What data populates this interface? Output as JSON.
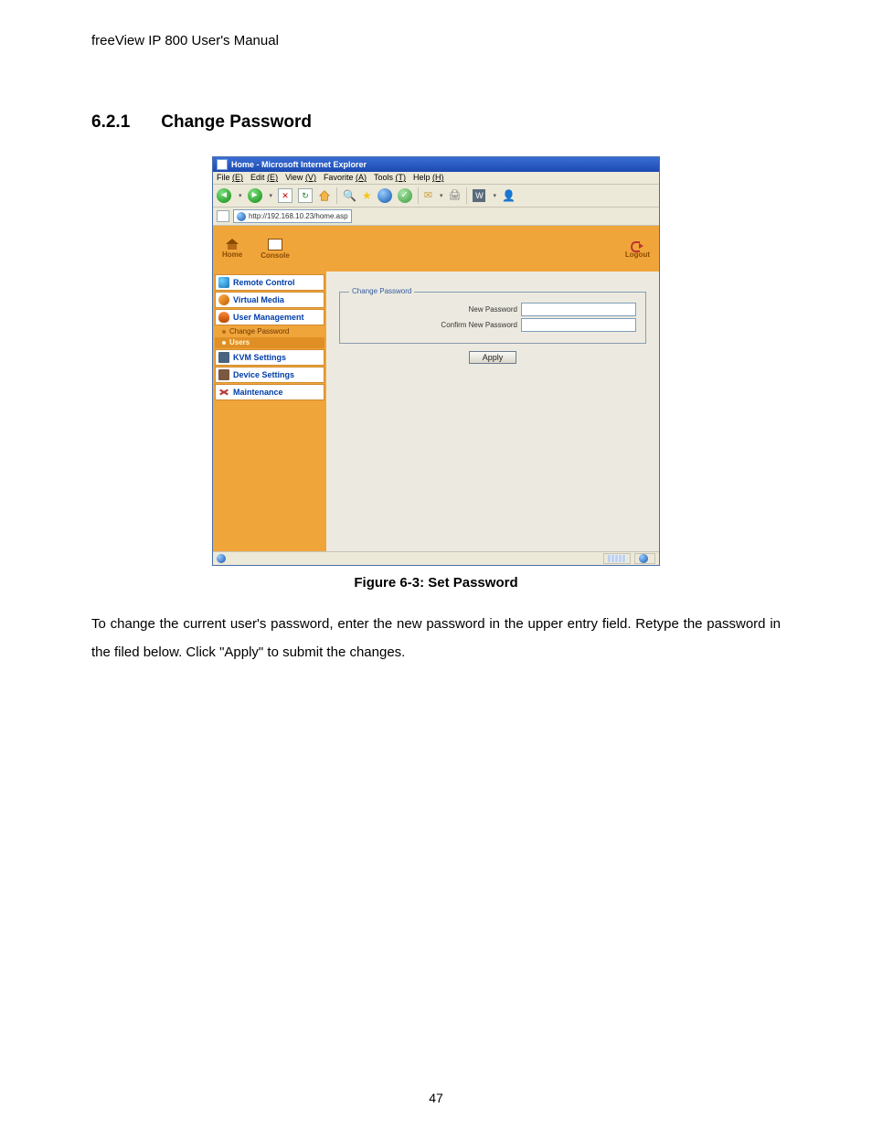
{
  "doc": {
    "header": "freeView IP 800 User's Manual",
    "section_number": "6.2.1",
    "section_title": "Change Password",
    "caption": "Figure 6-3: Set Password",
    "paragraph": "To change the current user's password, enter the new password in the upper entry field. Retype the password in the filed below. Click \"Apply\" to submit the changes.",
    "page_number": "47"
  },
  "browser": {
    "title": "Home - Microsoft Internet Explorer",
    "menu": {
      "file": "File",
      "edit": "Edit",
      "view": "View",
      "favorites": "Favorite",
      "tools": "Tools",
      "help": "Help"
    },
    "address_url": "http://192.168.10.23/home.asp",
    "top_links": {
      "home": "Home",
      "console": "Console",
      "logout": "Logout"
    },
    "sidebar": {
      "remote_control": "Remote Control",
      "virtual_media": "Virtual Media",
      "user_management": "User Management",
      "change_password": "Change Password",
      "users": "Users",
      "kvm_settings": "KVM Settings",
      "device_settings": "Device Settings",
      "maintenance": "Maintenance"
    },
    "form": {
      "legend": "Change Password",
      "new_password_label": "New Password",
      "confirm_label": "Confirm New Password",
      "apply": "Apply"
    },
    "status": {
      "left_icon": "done",
      "zone_label": ""
    }
  }
}
